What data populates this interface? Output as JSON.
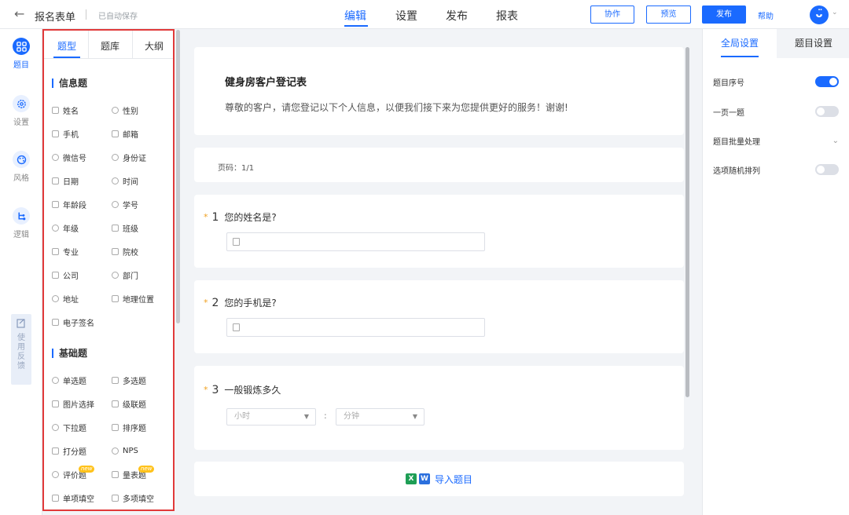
{
  "topbar": {
    "back_icon": "arrow-left-icon",
    "form_title": "报名表单",
    "autosave": "已自动保存",
    "tabs": [
      {
        "label": "编辑",
        "active": true
      },
      {
        "label": "设置",
        "active": false
      },
      {
        "label": "发布",
        "active": false
      },
      {
        "label": "报表",
        "active": false
      }
    ],
    "collab_label": "协作",
    "preview_label": "预览",
    "publish_label": "发布",
    "help_label": "帮助",
    "avatar_glyph": "ᴗ̈",
    "accent_color": "#1a6aff"
  },
  "rail": {
    "items": [
      {
        "label": "题目",
        "icon": "grid-icon",
        "active": true
      },
      {
        "label": "设置",
        "icon": "gear-icon",
        "active": false
      },
      {
        "label": "风格",
        "icon": "palette-icon",
        "active": false
      },
      {
        "label": "逻辑",
        "icon": "logic-icon",
        "active": false
      }
    ],
    "feedback_label": "使用反馈"
  },
  "palette": {
    "tabs": [
      "题型",
      "题库",
      "大纲"
    ],
    "active_tab": "题型",
    "sections": [
      {
        "title": "信息题",
        "items": [
          {
            "label": "姓名",
            "icon": "id-card-icon"
          },
          {
            "label": "性别",
            "icon": "gender-icon"
          },
          {
            "label": "手机",
            "icon": "phone-icon"
          },
          {
            "label": "邮箱",
            "icon": "mail-icon"
          },
          {
            "label": "微信号",
            "icon": "wechat-icon"
          },
          {
            "label": "身份证",
            "icon": "id-icon"
          },
          {
            "label": "日期",
            "icon": "calendar-icon"
          },
          {
            "label": "时间",
            "icon": "clock-icon"
          },
          {
            "label": "年龄段",
            "icon": "cake-icon"
          },
          {
            "label": "学号",
            "icon": "student-icon"
          },
          {
            "label": "年级",
            "icon": "grade-icon"
          },
          {
            "label": "班级",
            "icon": "class-icon"
          },
          {
            "label": "专业",
            "icon": "book-icon"
          },
          {
            "label": "院校",
            "icon": "school-icon"
          },
          {
            "label": "公司",
            "icon": "briefcase-icon"
          },
          {
            "label": "部门",
            "icon": "department-icon"
          },
          {
            "label": "地址",
            "icon": "location-icon"
          },
          {
            "label": "地理位置",
            "icon": "flag-icon"
          },
          {
            "label": "电子签名",
            "icon": "pen-icon"
          }
        ]
      },
      {
        "title": "基础题",
        "items": [
          {
            "label": "单选题",
            "icon": "radio-icon"
          },
          {
            "label": "多选题",
            "icon": "checkbox-icon"
          },
          {
            "label": "图片选择",
            "icon": "image-icon"
          },
          {
            "label": "级联题",
            "icon": "cascade-icon"
          },
          {
            "label": "下拉题",
            "icon": "dropdown-icon"
          },
          {
            "label": "排序题",
            "icon": "sort-icon"
          },
          {
            "label": "打分题",
            "icon": "thumb-up-icon"
          },
          {
            "label": "NPS",
            "icon": "gauge-icon"
          },
          {
            "label": "评价题",
            "icon": "smile-icon",
            "badge": "new"
          },
          {
            "label": "量表题",
            "icon": "star-icon",
            "badge": "new"
          },
          {
            "label": "单项填空",
            "icon": "text-field-icon"
          },
          {
            "label": "多项填空",
            "icon": "multi-text-icon"
          }
        ]
      }
    ]
  },
  "survey": {
    "title": "健身房客户登记表",
    "description": "尊敬的客户，请您登记以下个人信息，以便我们接下来为您提供更好的服务！谢谢!",
    "page_indicator": "页码：1/1",
    "questions": [
      {
        "star": "*",
        "number": "1",
        "text": "您的姓名是?",
        "input_icon": "id-card-icon"
      },
      {
        "star": "*",
        "number": "2",
        "text": "您的手机是?",
        "input_icon": "phone-icon"
      },
      {
        "star": "*",
        "number": "3",
        "text": "一般锻炼多久",
        "hour_placeholder": "小时",
        "minute_placeholder": "分钟",
        "separator": ":"
      }
    ],
    "import_label": "导入题目",
    "import_icons": [
      "excel-icon",
      "word-icon"
    ]
  },
  "settings": {
    "tabs": [
      "全局设置",
      "题目设置"
    ],
    "active_tab": "全局设置",
    "rows": [
      {
        "label": "题目序号",
        "type": "toggle",
        "on": true
      },
      {
        "label": "一页一题",
        "type": "toggle",
        "on": false
      },
      {
        "label": "题目批量处理",
        "type": "expand"
      },
      {
        "label": "选项随机排列",
        "type": "toggle",
        "on": false
      }
    ]
  }
}
